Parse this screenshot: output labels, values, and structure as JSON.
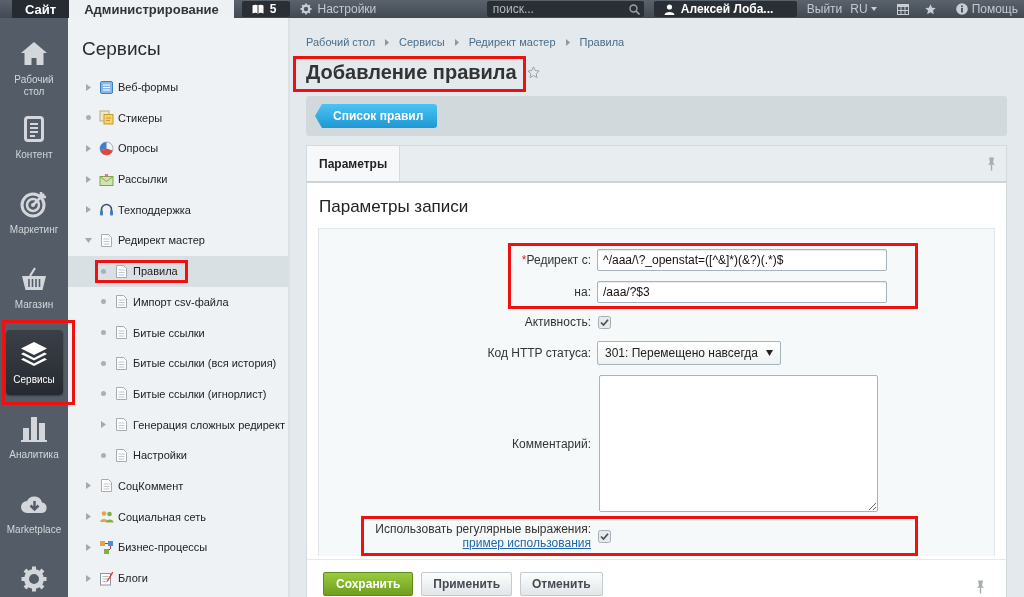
{
  "top_bar": {
    "tabs": [
      {
        "label": "Сайт",
        "selected": false
      },
      {
        "label": "Администрирование",
        "selected": true
      }
    ],
    "notifications": {
      "count": "5"
    },
    "settings": {
      "label": "Настройки"
    },
    "search": {
      "placeholder": "поиск..."
    },
    "user": {
      "name": "Алексей Лоба..."
    },
    "logout": {
      "label": "Выйти"
    },
    "language": {
      "label": "RU"
    },
    "help": {
      "label": "Помощь"
    }
  },
  "nav": {
    "items": [
      {
        "label": "Рабочий стол",
        "selected": false,
        "highlighted": false
      },
      {
        "label": "Контент",
        "selected": false,
        "highlighted": false
      },
      {
        "label": "Маркетинг",
        "selected": false,
        "highlighted": false
      },
      {
        "label": "Магазин",
        "selected": false,
        "highlighted": false
      },
      {
        "label": "Сервисы",
        "selected": true,
        "highlighted": true
      },
      {
        "label": "Аналитика",
        "selected": false,
        "highlighted": false
      },
      {
        "label": "Marketplace",
        "selected": false,
        "highlighted": false
      },
      {
        "selected": false,
        "highlighted": false
      }
    ]
  },
  "tree": {
    "title": "Сервисы",
    "items": [
      {
        "label": "Веб-формы",
        "kind": "folder",
        "expanded": false,
        "selected": false,
        "highlighted": false
      },
      {
        "label": "Стикеры",
        "kind": "leaf",
        "selected": false,
        "highlighted": false
      },
      {
        "label": "Опросы",
        "kind": "folder",
        "expanded": false,
        "selected": false,
        "highlighted": false
      },
      {
        "label": "Рассылки",
        "kind": "folder",
        "expanded": false,
        "selected": false,
        "highlighted": false
      },
      {
        "label": "Техподдержка",
        "kind": "folder",
        "expanded": false,
        "selected": false,
        "highlighted": false
      },
      {
        "label": "Редирект мастер",
        "kind": "folder",
        "expanded": true,
        "selected": false,
        "highlighted": false,
        "children": [
          {
            "label": "Правила",
            "kind": "leaf",
            "selected": true,
            "highlighted": true
          },
          {
            "label": "Импорт csv-файла",
            "kind": "leaf",
            "selected": false,
            "highlighted": false
          },
          {
            "label": "Битые ссылки",
            "kind": "leaf",
            "selected": false,
            "highlighted": false
          },
          {
            "label": "Битые ссылки (вся история)",
            "kind": "leaf",
            "selected": false,
            "highlighted": false
          },
          {
            "label": "Битые ссылки (игнорлист)",
            "kind": "leaf",
            "selected": false,
            "highlighted": false
          },
          {
            "label": "Генерация сложных редирект",
            "kind": "folder",
            "expanded": false,
            "selected": false,
            "highlighted": false
          },
          {
            "label": "Настройки",
            "kind": "leaf",
            "selected": false,
            "highlighted": false
          }
        ]
      },
      {
        "label": "СоцКоммент",
        "kind": "folder",
        "expanded": false,
        "selected": false,
        "highlighted": false
      },
      {
        "label": "Социальная сеть",
        "kind": "folder",
        "expanded": false,
        "selected": false,
        "highlighted": false
      },
      {
        "label": "Бизнес-процессы",
        "kind": "folder",
        "expanded": false,
        "selected": false,
        "highlighted": false
      },
      {
        "label": "Блоги",
        "kind": "folder",
        "expanded": false,
        "selected": false,
        "highlighted": false
      }
    ]
  },
  "header": {
    "breadcrumbs": [
      "Рабочий стол",
      "Сервисы",
      "Редирект мастер",
      "Правила"
    ],
    "title": {
      "text": "Добавление правила",
      "highlighted": true
    }
  },
  "toolbar": {
    "back_button": {
      "label": "Список правил"
    }
  },
  "tabs": [
    {
      "label": "Параметры",
      "selected": true
    }
  ],
  "form": {
    "heading": "Параметры записи",
    "groups": [
      {
        "highlighted": true,
        "rows": [
          {
            "kind": "text",
            "required_mark": "*",
            "label": "Редирект с:",
            "value": "^/aaa/\\?_openstat=([^&]*)(&?)(.*)$"
          },
          {
            "kind": "text",
            "label": "на:",
            "value": "/aaa/?$3"
          }
        ]
      },
      {
        "highlighted": false,
        "rows": [
          {
            "kind": "checkbox",
            "label": "Активность:",
            "checked": true
          },
          {
            "kind": "select",
            "label": "Код HTTP статуса:",
            "value": "301: Перемещено навсегда"
          },
          {
            "kind": "textarea",
            "label": "Комментарий:"
          }
        ]
      },
      {
        "highlighted": true,
        "rows": [
          {
            "kind": "checkbox",
            "label": "Использовать регулярные выражения:",
            "link": "пример использования",
            "checked": true
          }
        ]
      }
    ]
  },
  "footer": {
    "buttons": [
      {
        "label": "Сохранить",
        "kind": "primary"
      },
      {
        "label": "Применить",
        "kind": "secondary"
      },
      {
        "label": "Отменить",
        "kind": "secondary"
      }
    ]
  }
}
